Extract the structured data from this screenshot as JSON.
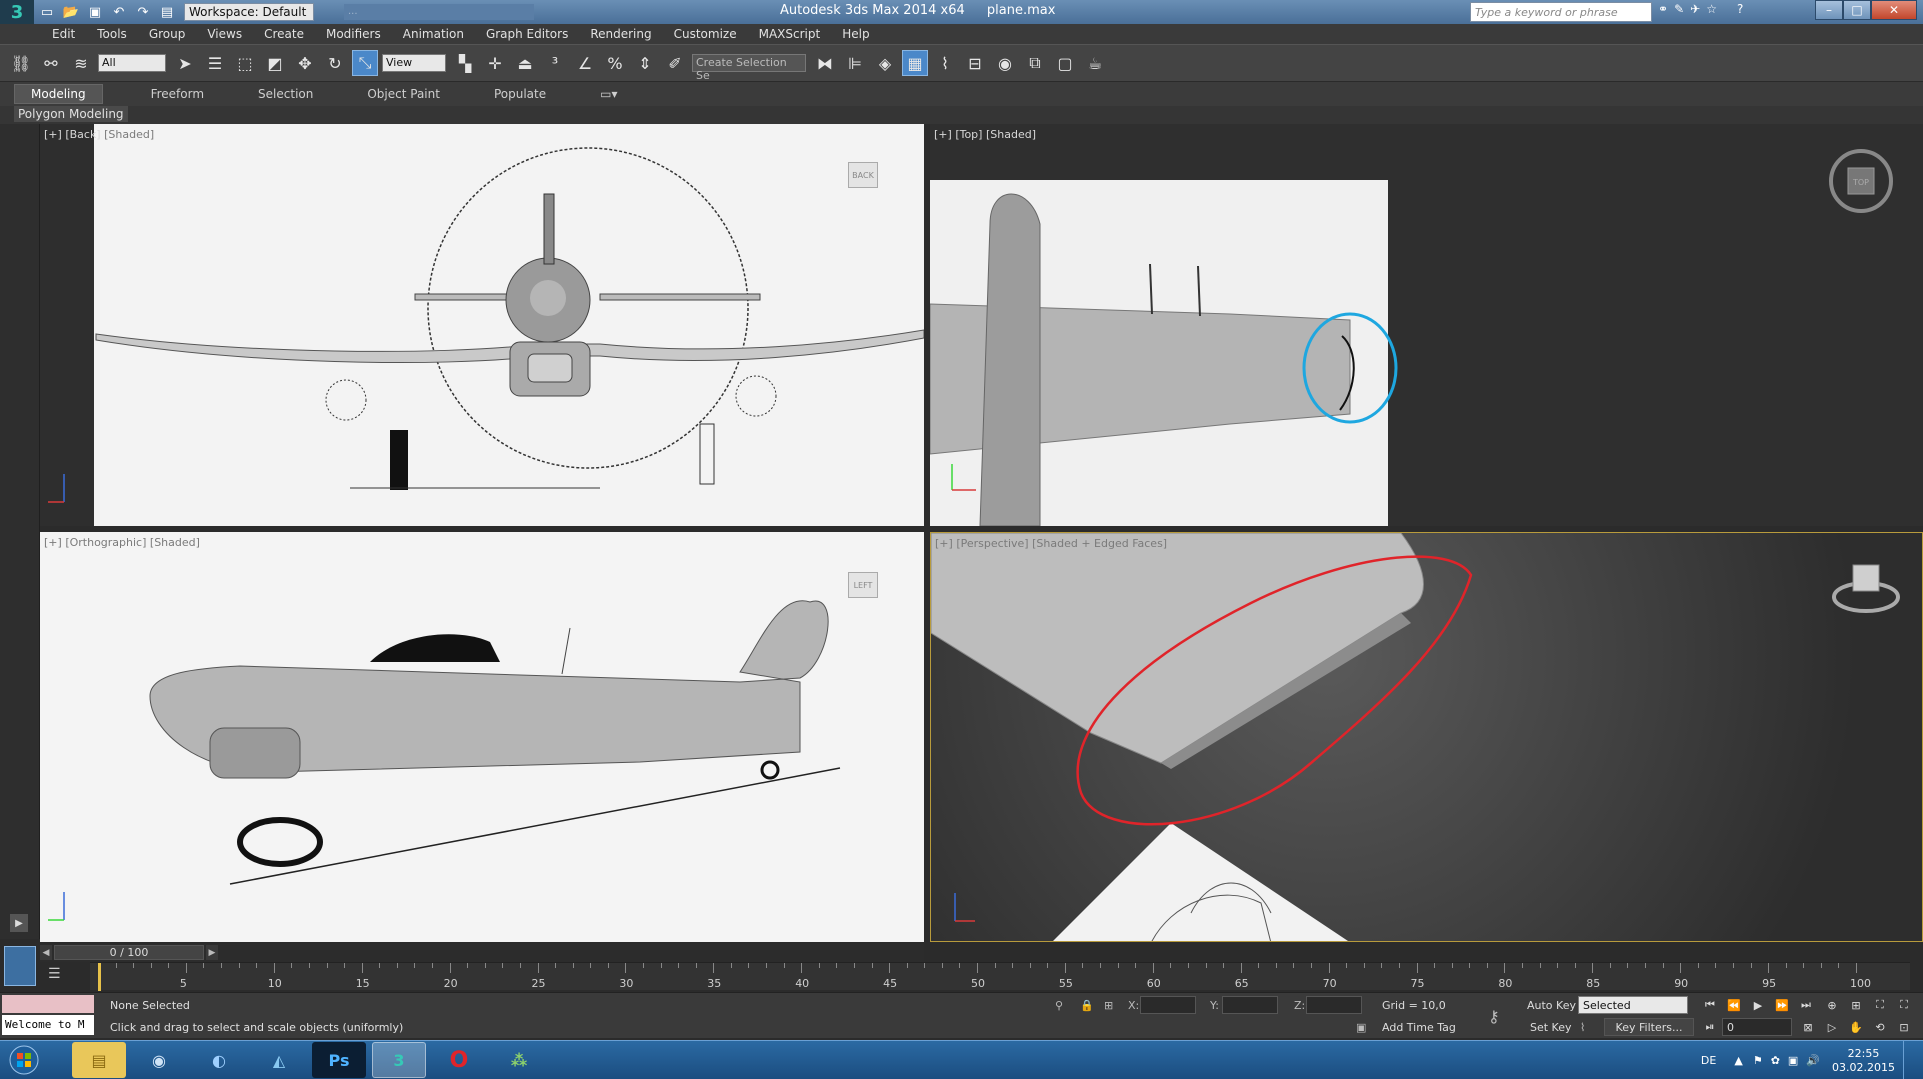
{
  "titlebar": {
    "workspace": "Workspace: Default",
    "blurred_path": "...",
    "title": "Autodesk 3ds Max  2014 x64",
    "filename": "plane.max",
    "search_placeholder": "Type a keyword or phrase",
    "min": "–",
    "max": "□",
    "close": "✕"
  },
  "menu": [
    "Edit",
    "Tools",
    "Group",
    "Views",
    "Create",
    "Modifiers",
    "Animation",
    "Graph Editors",
    "Rendering",
    "Customize",
    "MAXScript",
    "Help"
  ],
  "toolbar": {
    "selection_filter": "All",
    "ref_coord": "View",
    "named_selection": "Create Selection Se"
  },
  "ribbon": {
    "tabs": [
      "Modeling",
      "Freeform",
      "Selection",
      "Object Paint",
      "Populate"
    ],
    "active_tab": "Modeling",
    "sub_label": "Polygon Modeling"
  },
  "viewports": {
    "back": {
      "plus": "[+]",
      "view": "[Back]",
      "mode": "[Shaded]",
      "cube_label": "BACK"
    },
    "top": {
      "plus": "[+]",
      "view": "[Top]",
      "mode": "[Shaded]",
      "cube_label": "TOP"
    },
    "ortho": {
      "plus": "[+]",
      "view": "[Orthographic]",
      "mode": "[Shaded]",
      "cube_label": "LEFT"
    },
    "persp": {
      "plus": "[+]",
      "view": "[Perspective]",
      "mode": "[Shaded + Edged Faces]"
    }
  },
  "timeline": {
    "frame_display": "0 / 100",
    "ticks": [
      "5",
      "10",
      "15",
      "20",
      "25",
      "30",
      "35",
      "40",
      "45",
      "50",
      "55",
      "60",
      "65",
      "70",
      "75",
      "80",
      "85",
      "90",
      "95",
      "100"
    ]
  },
  "status": {
    "maxscript_welcome": "Welcome to M",
    "selection": "None Selected",
    "prompt": "Click and drag to select and scale objects (uniformly)",
    "x_label": "X:",
    "y_label": "Y:",
    "z_label": "Z:",
    "grid": "Grid = 10,0",
    "add_time_tag": "Add Time Tag",
    "auto_key": "Auto Key",
    "set_key": "Set Key",
    "selected_option": "Selected",
    "key_filters": "Key Filters...",
    "frame_value": "0"
  },
  "taskbar": {
    "ps_label": "Ps",
    "lang": "DE",
    "time": "22:55",
    "date": "03.02.2015"
  },
  "colors": {
    "selection_blue": "#4b88c9",
    "annotation_red": "#e0242a",
    "annotation_blue": "#1ea7e0",
    "viewport_highlight": "#b89b3c"
  }
}
